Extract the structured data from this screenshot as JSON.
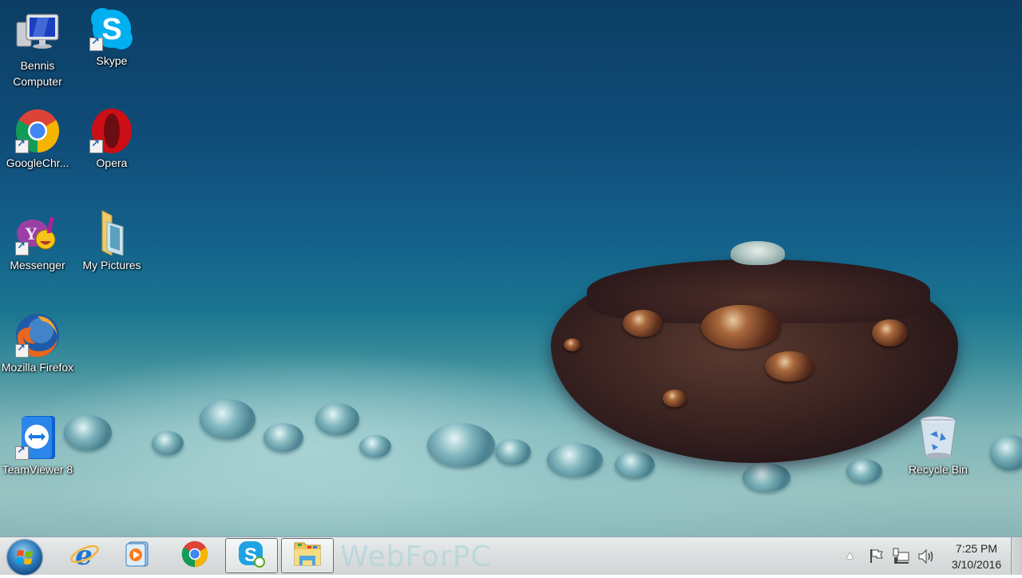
{
  "desktop": {
    "wallpaper": "coffee bean with water droplets on blue-teal bubbles",
    "icons": [
      {
        "label": "Bennis Computer",
        "icon": "computer-icon",
        "shortcut": false
      },
      {
        "label": "Skype",
        "icon": "skype-icon",
        "shortcut": true
      },
      {
        "label": "GoogleChr...",
        "icon": "chrome-icon",
        "shortcut": true
      },
      {
        "label": "Opera",
        "icon": "opera-icon",
        "shortcut": true
      },
      {
        "label": "Messenger",
        "icon": "yahoo-messenger-icon",
        "shortcut": true
      },
      {
        "label": "My Pictures",
        "icon": "folder-icon",
        "shortcut": false
      },
      {
        "label": "Mozilla Firefox",
        "icon": "firefox-icon",
        "shortcut": true
      },
      {
        "label": "TeamViewer 8",
        "icon": "teamviewer-icon",
        "shortcut": true
      },
      {
        "label": "Recycle Bin",
        "icon": "recycle-bin-icon",
        "shortcut": false
      }
    ]
  },
  "taskbar": {
    "start_button": "start-orb-icon",
    "pinned": [
      {
        "name": "Internet Explorer",
        "icon": "internet-explorer-icon",
        "active": false
      },
      {
        "name": "Windows Media Player",
        "icon": "media-player-icon",
        "active": false
      },
      {
        "name": "Google Chrome",
        "icon": "chrome-icon",
        "active": false
      },
      {
        "name": "Skype",
        "icon": "skype-icon",
        "active": true
      },
      {
        "name": "Windows Explorer",
        "icon": "file-explorer-icon",
        "active": true
      }
    ],
    "watermark": "WebForPC",
    "tray": {
      "show_hidden": "▲",
      "icons": [
        "action-center-flag-icon",
        "network-icon",
        "volume-icon"
      ],
      "time": "7:25 PM",
      "date": "3/10/2016"
    }
  },
  "colors": {
    "skype_blue": "#00aff0",
    "taskbar_bg": "#dcdfe0",
    "label_text": "#ffffff"
  }
}
